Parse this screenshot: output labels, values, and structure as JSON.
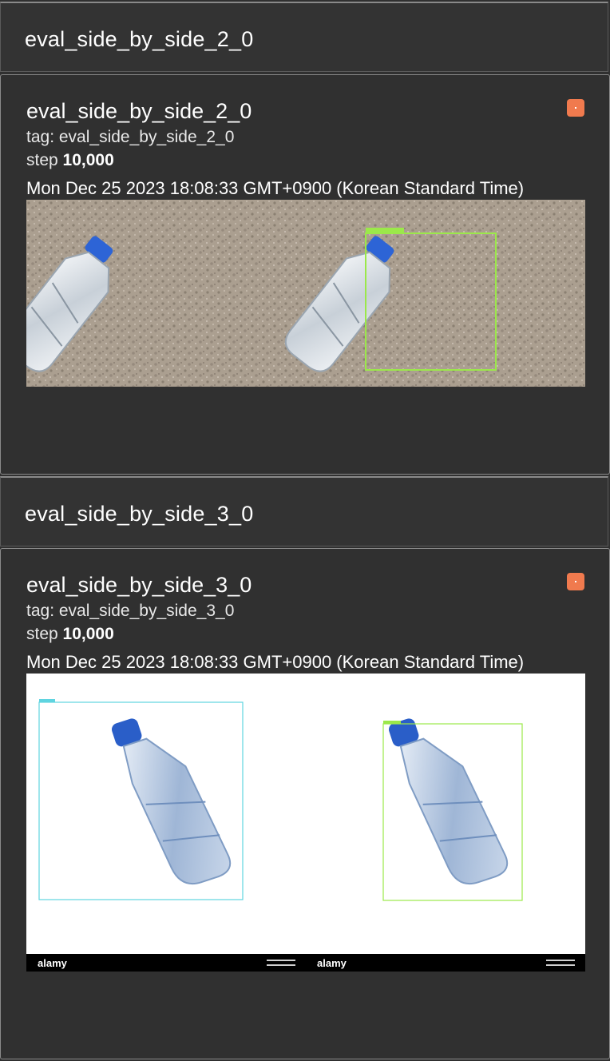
{
  "sections": [
    {
      "group_title": "eval_side_by_side_2_0",
      "card": {
        "title": "eval_side_by_side_2_0",
        "tag": "tag: eval_side_by_side_2_0",
        "step_label": "step",
        "step_value": "10,000",
        "timestamp": "Mon Dec 25 2023 18:08:33 GMT+0900 (Korean Standard Time)",
        "run_color": "#f07a4e"
      }
    },
    {
      "group_title": "eval_side_by_side_3_0",
      "card": {
        "title": "eval_side_by_side_3_0",
        "tag": "tag: eval_side_by_side_3_0",
        "step_label": "step",
        "step_value": "10,000",
        "timestamp": "Mon Dec 25 2023 18:08:33 GMT+0900 (Korean Standard Time)",
        "run_color": "#f07a4e"
      }
    }
  ],
  "images": {
    "first": {
      "description_icon": "bottle-on-sand-image",
      "box_color": "#9be84a"
    },
    "second": {
      "description_icon": "bottle-on-white-image",
      "box_color_left": "#5fd4e0",
      "box_color_right": "#9be84a",
      "watermark": "alamy"
    }
  }
}
